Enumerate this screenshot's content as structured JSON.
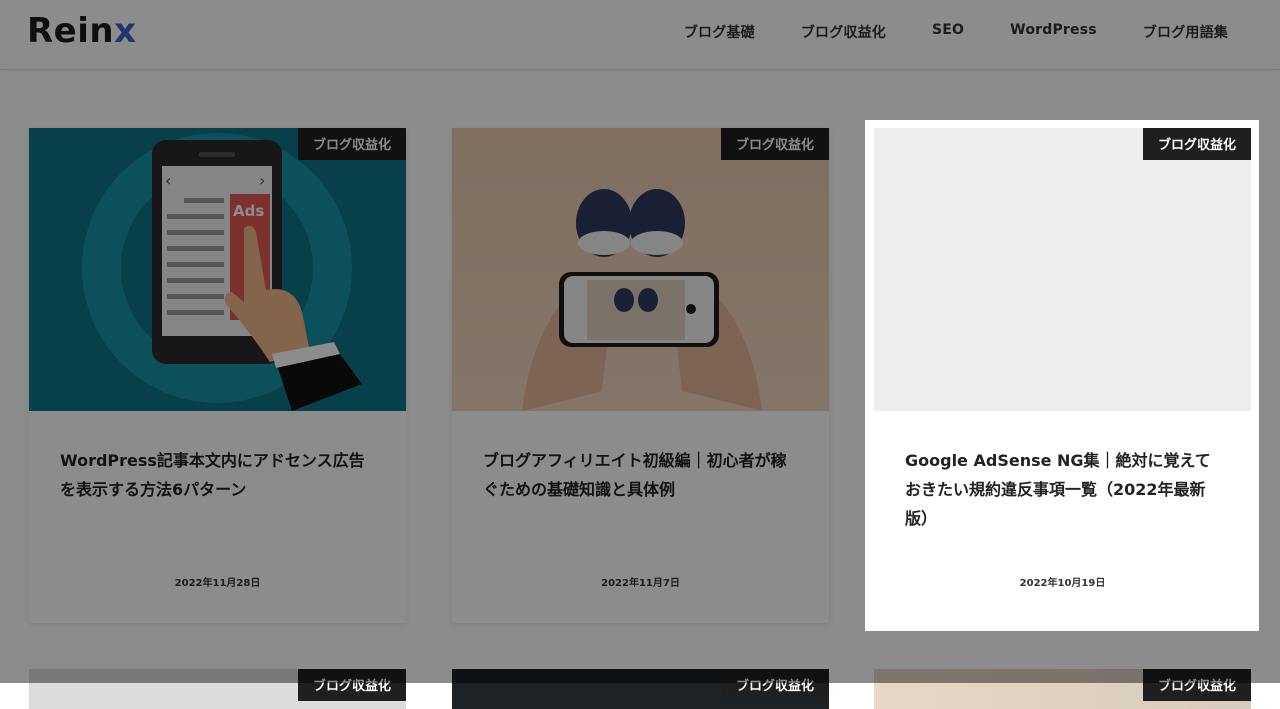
{
  "header": {
    "logo_main": "Rein",
    "logo_accent": "x",
    "nav": [
      {
        "label": "ブログ基礎"
      },
      {
        "label": "ブログ収益化"
      },
      {
        "label": "SEO"
      },
      {
        "label": "WordPress"
      },
      {
        "label": "ブログ用語集"
      }
    ]
  },
  "cards": [
    {
      "category": "ブログ収益化",
      "title": "WordPress記事本文内にアドセンス広告を表示する方法6パターン",
      "date": "2022年11月28日",
      "thumb_label": "Ads"
    },
    {
      "category": "ブログ収益化",
      "title": "ブログアフィリエイト初級編｜初心者が稼ぐための基礎知識と具体例",
      "date": "2022年11月7日"
    },
    {
      "category": "ブログ収益化",
      "title": "Google AdSense NG集｜絶対に覚えておきたい規約違反事項一覧（2022年最新版）",
      "date": "2022年10月19日"
    }
  ],
  "row2": [
    {
      "category": "ブログ収益化"
    },
    {
      "category": "ブログ収益化"
    },
    {
      "category": "ブログ収益化"
    }
  ],
  "colors": {
    "accent": "#3c63c9",
    "category_bg": "#1f1f1f",
    "overlay": "rgba(0,0,0,0.45)"
  }
}
